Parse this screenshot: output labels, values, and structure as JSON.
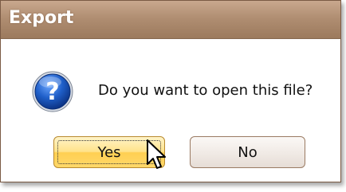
{
  "dialog": {
    "title": "Export",
    "message": "Do you want to open this file?",
    "icon": "question-icon",
    "buttons": {
      "yes_label": "Yes",
      "no_label": "No"
    },
    "focused_button": "Yes"
  },
  "colors": {
    "titlebar": "#b08e72",
    "yes_button": "#ffd86a",
    "no_button": "#f1ebe6",
    "icon_blue": "#1e5bb8"
  }
}
